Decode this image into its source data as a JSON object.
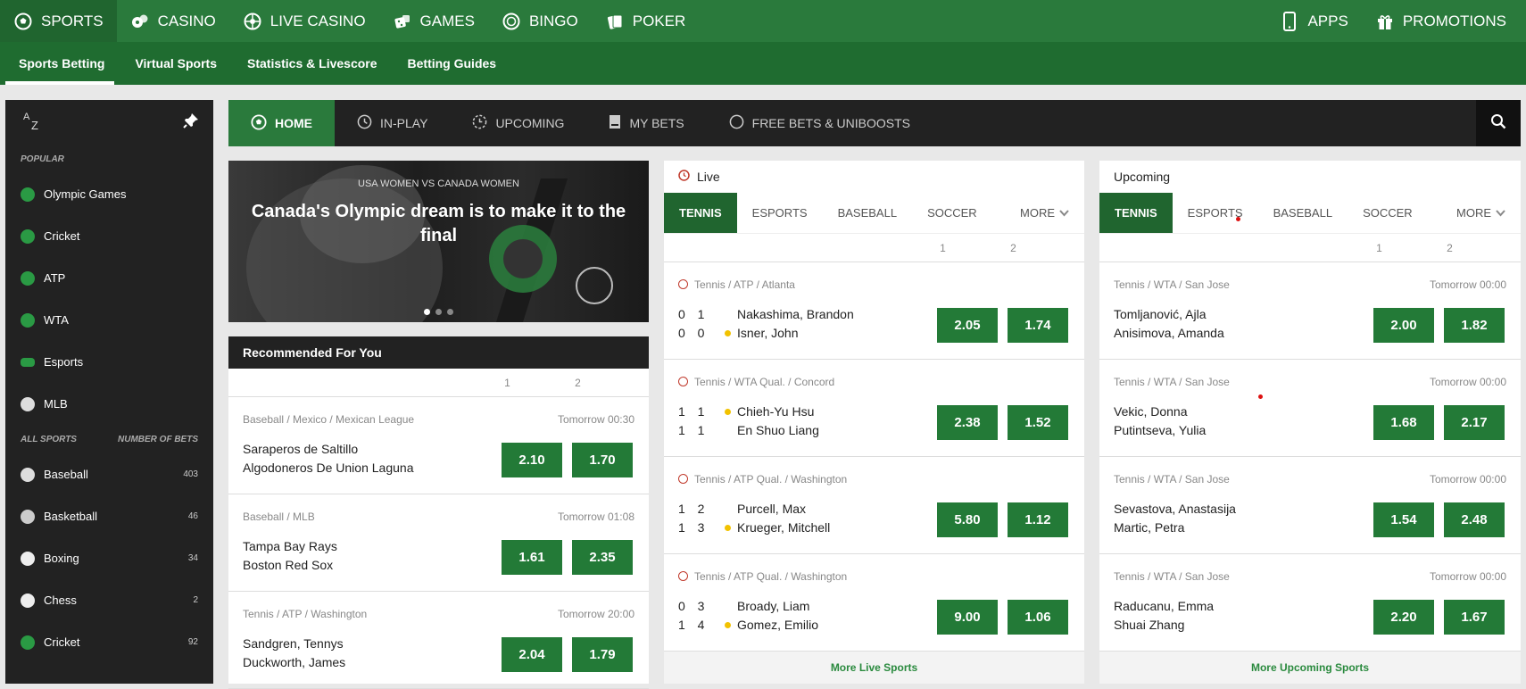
{
  "topnav": {
    "items": [
      {
        "label": "SPORTS",
        "icon": "soccer-ball-icon",
        "active": true
      },
      {
        "label": "CASINO",
        "icon": "casino-chip-icon"
      },
      {
        "label": "LIVE CASINO",
        "icon": "roulette-icon"
      },
      {
        "label": "GAMES",
        "icon": "dice-icon"
      },
      {
        "label": "BINGO",
        "icon": "bingo-ball-icon"
      },
      {
        "label": "POKER",
        "icon": "cards-icon"
      }
    ],
    "right": [
      {
        "label": "APPS",
        "icon": "mobile-icon"
      },
      {
        "label": "PROMOTIONS",
        "icon": "gift-icon"
      }
    ]
  },
  "subnav": [
    "Sports Betting",
    "Virtual Sports",
    "Statistics & Livescore",
    "Betting Guides"
  ],
  "sidebar": {
    "popular_caption": "POPULAR",
    "popular": [
      {
        "label": "Olympic Games",
        "icon": "olympic-icon"
      },
      {
        "label": "Cricket",
        "icon": "cricket-icon"
      },
      {
        "label": "ATP",
        "icon": "tennis-icon"
      },
      {
        "label": "WTA",
        "icon": "tennis-icon"
      },
      {
        "label": "Esports",
        "icon": "gamepad-icon"
      },
      {
        "label": "MLB",
        "icon": "baseball-icon"
      }
    ],
    "all_caption": "ALL SPORTS",
    "count_caption": "NUMBER OF BETS",
    "all": [
      {
        "label": "Baseball",
        "count": "403",
        "icon": "baseball-icon"
      },
      {
        "label": "Basketball",
        "count": "46",
        "icon": "basketball-icon"
      },
      {
        "label": "Boxing",
        "count": "34",
        "icon": "boxing-glove-icon"
      },
      {
        "label": "Chess",
        "count": "2",
        "icon": "chess-knight-icon"
      },
      {
        "label": "Cricket",
        "count": "92",
        "icon": "cricket-icon"
      }
    ]
  },
  "mainbar": [
    {
      "label": "HOME",
      "icon": "soccer-ball-icon",
      "active": true
    },
    {
      "label": "IN-PLAY",
      "icon": "clock-icon"
    },
    {
      "label": "UPCOMING",
      "icon": "timer-icon"
    },
    {
      "label": "MY BETS",
      "icon": "betslip-icon"
    },
    {
      "label": "FREE BETS & UNIBOOSTS",
      "icon": "boost-icon"
    }
  ],
  "banner": {
    "subtitle": "USA WOMEN VS CANADA WOMEN",
    "title": "Canada's Olympic dream is to make it to the final"
  },
  "recommended": {
    "title": "Recommended For You",
    "cols": [
      "1",
      "2"
    ],
    "rows": [
      {
        "league": "Baseball / Mexico / Mexican League",
        "time": "Tomorrow 00:30",
        "team1": "Saraperos de Saltillo",
        "team2": "Algodoneros De Union Laguna",
        "odd1": "2.10",
        "odd2": "1.70"
      },
      {
        "league": "Baseball / MLB",
        "time": "Tomorrow 01:08",
        "team1": "Tampa Bay Rays",
        "team2": "Boston Red Sox",
        "odd1": "1.61",
        "odd2": "2.35"
      },
      {
        "league": "Tennis / ATP / Washington",
        "time": "Tomorrow 20:00",
        "team1": "Sandgren, Tennys",
        "team2": "Duckworth, James",
        "odd1": "2.04",
        "odd2": "1.79"
      }
    ]
  },
  "live": {
    "title": "Live",
    "tabs": [
      "TENNIS",
      "ESPORTS",
      "BASEBALL",
      "SOCCER"
    ],
    "more": "MORE",
    "cols": [
      "1",
      "2"
    ],
    "rows": [
      {
        "league": "Tennis / ATP / Atlanta",
        "s1": "0 1",
        "s2": "0 0",
        "serve": 2,
        "team1": "Nakashima, Brandon",
        "team2": "Isner, John",
        "odd1": "2.05",
        "odd2": "1.74"
      },
      {
        "league": "Tennis / WTA Qual. / Concord",
        "s1": "1 1",
        "s2": "1 1",
        "serve": 1,
        "team1": "Chieh-Yu Hsu",
        "team2": "En Shuo Liang",
        "odd1": "2.38",
        "odd2": "1.52"
      },
      {
        "league": "Tennis / ATP Qual. / Washington",
        "s1": "1 2",
        "s2": "1 3",
        "serve": 2,
        "team1": "Purcell, Max",
        "team2": "Krueger, Mitchell",
        "odd1": "5.80",
        "odd2": "1.12"
      },
      {
        "league": "Tennis / ATP Qual. / Washington",
        "s1": "0 3",
        "s2": "1 4",
        "serve": 2,
        "team1": "Broady, Liam",
        "team2": "Gomez, Emilio",
        "odd1": "9.00",
        "odd2": "1.06"
      }
    ],
    "more_link": "More Live Sports"
  },
  "upcoming": {
    "title": "Upcoming",
    "tabs": [
      "TENNIS",
      "ESPORTS",
      "BASEBALL",
      "SOCCER"
    ],
    "more": "MORE",
    "cols": [
      "1",
      "2"
    ],
    "rows": [
      {
        "league": "Tennis / WTA / San Jose",
        "time": "Tomorrow 00:00",
        "team1": "Tomljanović, Ajla",
        "team2": "Anisimova, Amanda",
        "odd1": "2.00",
        "odd2": "1.82"
      },
      {
        "league": "Tennis / WTA / San Jose",
        "time": "Tomorrow 00:00",
        "team1": "Vekic, Donna",
        "team2": "Putintseva, Yulia",
        "odd1": "1.68",
        "odd2": "2.17"
      },
      {
        "league": "Tennis / WTA / San Jose",
        "time": "Tomorrow 00:00",
        "team1": "Sevastova, Anastasija",
        "team2": "Martic, Petra",
        "odd1": "1.54",
        "odd2": "2.48"
      },
      {
        "league": "Tennis / WTA / San Jose",
        "time": "Tomorrow 00:00",
        "team1": "Raducanu, Emma",
        "team2": "Shuai Zhang",
        "odd1": "2.20",
        "odd2": "1.67"
      }
    ],
    "more_link": "More Upcoming Sports"
  },
  "colors": {
    "brand_green": "#2a7a3c",
    "dark_green": "#20652f",
    "odds_green": "#237a37",
    "serve_yellow": "#f2c200",
    "live_red": "#c0392b"
  }
}
